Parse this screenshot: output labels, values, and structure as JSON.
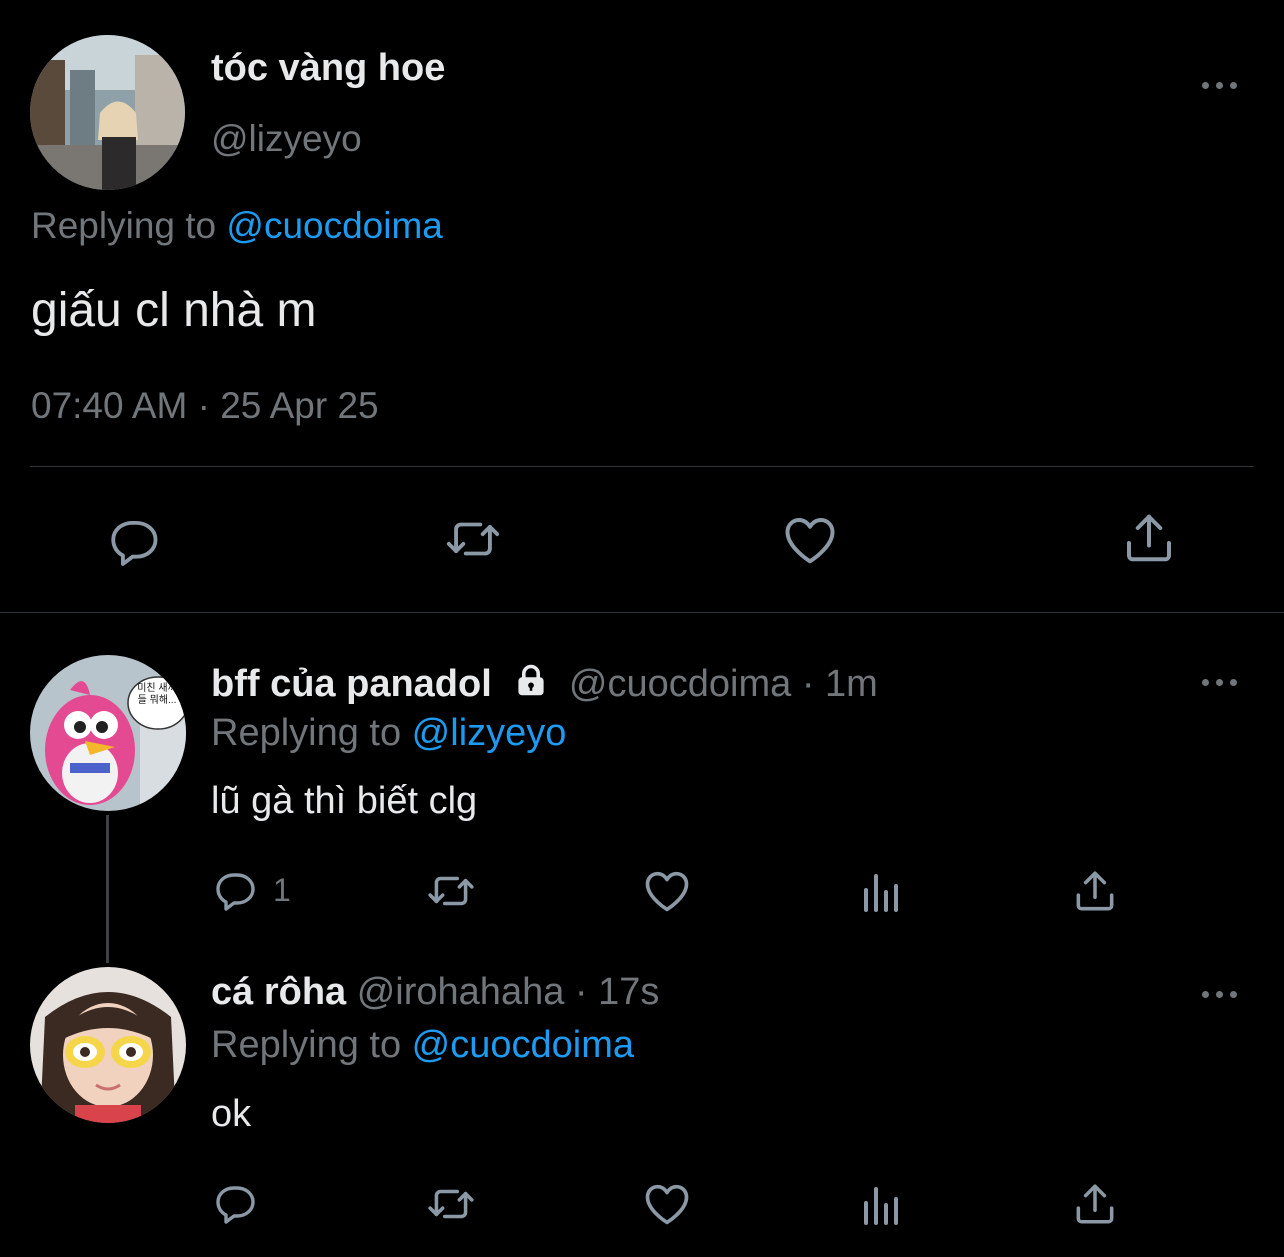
{
  "main_tweet": {
    "display_name": "tóc vàng hoe",
    "handle": "@lizyeyo",
    "replying_prefix": "Replying to ",
    "replying_to": "@cuocdoima",
    "text": "giấu cl nhà m",
    "timestamp": "07:40 AM · 25 Apr 25"
  },
  "replies": [
    {
      "display_name": "bff của panadol",
      "handle": "@cuocdoima",
      "time": "· 1m",
      "replying_prefix": "Replying to ",
      "replying_to": "@lizyeyo",
      "text": "lũ gà thì biết clg",
      "reply_count": "1",
      "avatar_bubble": "미친 새끼들 뭐해..."
    },
    {
      "display_name": "cá rôha",
      "handle": "@irohahaha",
      "time": "· 17s",
      "replying_prefix": "Replying to ",
      "replying_to": "@cuocdoima",
      "text": "ok",
      "reply_count": ""
    }
  ],
  "colors": {
    "background": "#000000",
    "primary_text": "#e7e9ea",
    "secondary_text": "#71767b",
    "link": "#1d9bf0",
    "divider": "#2f3336"
  },
  "icons": [
    "reply-icon",
    "retweet-icon",
    "like-icon",
    "share-icon",
    "views-icon",
    "more-icon",
    "lock-icon"
  ]
}
